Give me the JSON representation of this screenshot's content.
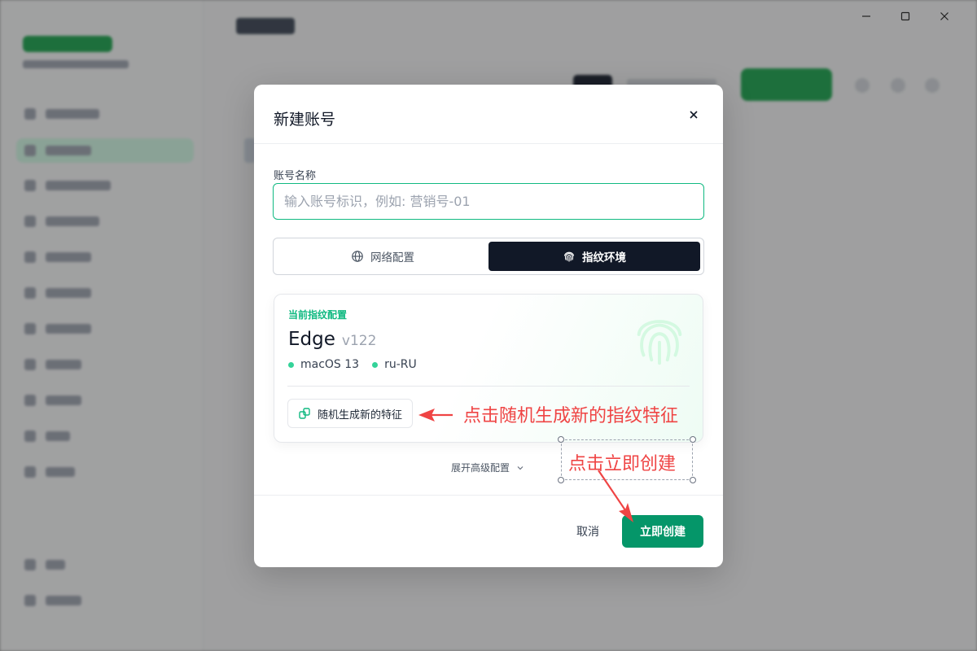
{
  "window": {
    "minimize_icon": "minimize-icon",
    "maximize_icon": "maximize-icon",
    "close_icon": "close-icon"
  },
  "modal": {
    "title": "新建账号",
    "close_glyph": "×",
    "name_field": {
      "label": "账号名称",
      "value": "",
      "placeholder": "输入账号标识，例如: 营销号-01"
    },
    "tabs": [
      {
        "label": "网络配置",
        "icon": "globe-icon",
        "active": false
      },
      {
        "label": "指纹环境",
        "icon": "fingerprint-icon",
        "active": true
      }
    ],
    "fingerprint": {
      "section_label": "当前指纹配置",
      "browser": "Edge",
      "version": "v122",
      "os": "macOS 13",
      "locale": "ru-RU",
      "regenerate_label": "随机生成新的特征"
    },
    "advanced_label": "展开高级配置",
    "cancel_label": "取消",
    "create_label": "立即创建"
  },
  "annotations": {
    "regenerate_hint": "点击随机生成新的指纹特征",
    "create_hint": "点击立即创建"
  },
  "colors": {
    "accent": "#059669",
    "accent_light": "#10b981",
    "annotation": "#ef4444",
    "tab_active_bg": "#111827"
  }
}
